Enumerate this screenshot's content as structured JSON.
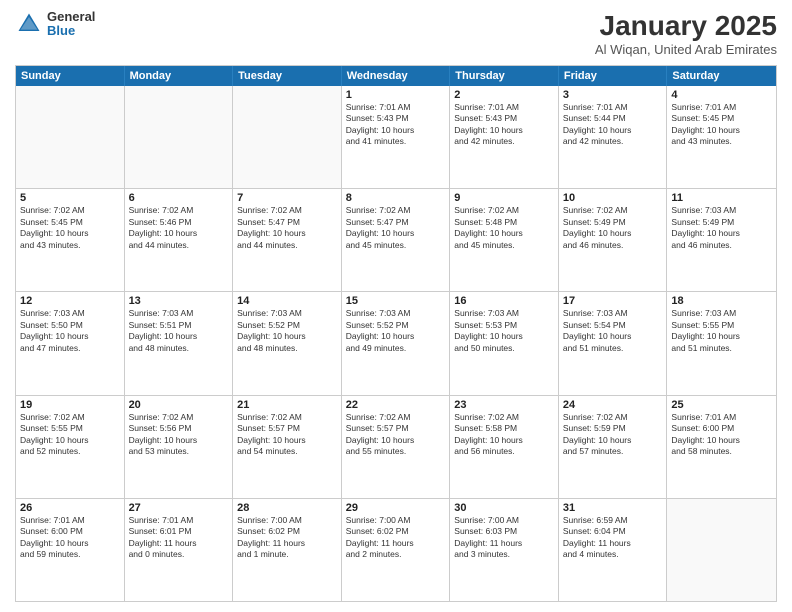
{
  "header": {
    "logo_general": "General",
    "logo_blue": "Blue",
    "title": "January 2025",
    "location": "Al Wiqan, United Arab Emirates"
  },
  "day_headers": [
    "Sunday",
    "Monday",
    "Tuesday",
    "Wednesday",
    "Thursday",
    "Friday",
    "Saturday"
  ],
  "weeks": [
    [
      {
        "num": "",
        "info": ""
      },
      {
        "num": "",
        "info": ""
      },
      {
        "num": "",
        "info": ""
      },
      {
        "num": "1",
        "info": "Sunrise: 7:01 AM\nSunset: 5:43 PM\nDaylight: 10 hours\nand 41 minutes."
      },
      {
        "num": "2",
        "info": "Sunrise: 7:01 AM\nSunset: 5:43 PM\nDaylight: 10 hours\nand 42 minutes."
      },
      {
        "num": "3",
        "info": "Sunrise: 7:01 AM\nSunset: 5:44 PM\nDaylight: 10 hours\nand 42 minutes."
      },
      {
        "num": "4",
        "info": "Sunrise: 7:01 AM\nSunset: 5:45 PM\nDaylight: 10 hours\nand 43 minutes."
      }
    ],
    [
      {
        "num": "5",
        "info": "Sunrise: 7:02 AM\nSunset: 5:45 PM\nDaylight: 10 hours\nand 43 minutes."
      },
      {
        "num": "6",
        "info": "Sunrise: 7:02 AM\nSunset: 5:46 PM\nDaylight: 10 hours\nand 44 minutes."
      },
      {
        "num": "7",
        "info": "Sunrise: 7:02 AM\nSunset: 5:47 PM\nDaylight: 10 hours\nand 44 minutes."
      },
      {
        "num": "8",
        "info": "Sunrise: 7:02 AM\nSunset: 5:47 PM\nDaylight: 10 hours\nand 45 minutes."
      },
      {
        "num": "9",
        "info": "Sunrise: 7:02 AM\nSunset: 5:48 PM\nDaylight: 10 hours\nand 45 minutes."
      },
      {
        "num": "10",
        "info": "Sunrise: 7:02 AM\nSunset: 5:49 PM\nDaylight: 10 hours\nand 46 minutes."
      },
      {
        "num": "11",
        "info": "Sunrise: 7:03 AM\nSunset: 5:49 PM\nDaylight: 10 hours\nand 46 minutes."
      }
    ],
    [
      {
        "num": "12",
        "info": "Sunrise: 7:03 AM\nSunset: 5:50 PM\nDaylight: 10 hours\nand 47 minutes."
      },
      {
        "num": "13",
        "info": "Sunrise: 7:03 AM\nSunset: 5:51 PM\nDaylight: 10 hours\nand 48 minutes."
      },
      {
        "num": "14",
        "info": "Sunrise: 7:03 AM\nSunset: 5:52 PM\nDaylight: 10 hours\nand 48 minutes."
      },
      {
        "num": "15",
        "info": "Sunrise: 7:03 AM\nSunset: 5:52 PM\nDaylight: 10 hours\nand 49 minutes."
      },
      {
        "num": "16",
        "info": "Sunrise: 7:03 AM\nSunset: 5:53 PM\nDaylight: 10 hours\nand 50 minutes."
      },
      {
        "num": "17",
        "info": "Sunrise: 7:03 AM\nSunset: 5:54 PM\nDaylight: 10 hours\nand 51 minutes."
      },
      {
        "num": "18",
        "info": "Sunrise: 7:03 AM\nSunset: 5:55 PM\nDaylight: 10 hours\nand 51 minutes."
      }
    ],
    [
      {
        "num": "19",
        "info": "Sunrise: 7:02 AM\nSunset: 5:55 PM\nDaylight: 10 hours\nand 52 minutes."
      },
      {
        "num": "20",
        "info": "Sunrise: 7:02 AM\nSunset: 5:56 PM\nDaylight: 10 hours\nand 53 minutes."
      },
      {
        "num": "21",
        "info": "Sunrise: 7:02 AM\nSunset: 5:57 PM\nDaylight: 10 hours\nand 54 minutes."
      },
      {
        "num": "22",
        "info": "Sunrise: 7:02 AM\nSunset: 5:57 PM\nDaylight: 10 hours\nand 55 minutes."
      },
      {
        "num": "23",
        "info": "Sunrise: 7:02 AM\nSunset: 5:58 PM\nDaylight: 10 hours\nand 56 minutes."
      },
      {
        "num": "24",
        "info": "Sunrise: 7:02 AM\nSunset: 5:59 PM\nDaylight: 10 hours\nand 57 minutes."
      },
      {
        "num": "25",
        "info": "Sunrise: 7:01 AM\nSunset: 6:00 PM\nDaylight: 10 hours\nand 58 minutes."
      }
    ],
    [
      {
        "num": "26",
        "info": "Sunrise: 7:01 AM\nSunset: 6:00 PM\nDaylight: 10 hours\nand 59 minutes."
      },
      {
        "num": "27",
        "info": "Sunrise: 7:01 AM\nSunset: 6:01 PM\nDaylight: 11 hours\nand 0 minutes."
      },
      {
        "num": "28",
        "info": "Sunrise: 7:00 AM\nSunset: 6:02 PM\nDaylight: 11 hours\nand 1 minute."
      },
      {
        "num": "29",
        "info": "Sunrise: 7:00 AM\nSunset: 6:02 PM\nDaylight: 11 hours\nand 2 minutes."
      },
      {
        "num": "30",
        "info": "Sunrise: 7:00 AM\nSunset: 6:03 PM\nDaylight: 11 hours\nand 3 minutes."
      },
      {
        "num": "31",
        "info": "Sunrise: 6:59 AM\nSunset: 6:04 PM\nDaylight: 11 hours\nand 4 minutes."
      },
      {
        "num": "",
        "info": ""
      }
    ]
  ]
}
